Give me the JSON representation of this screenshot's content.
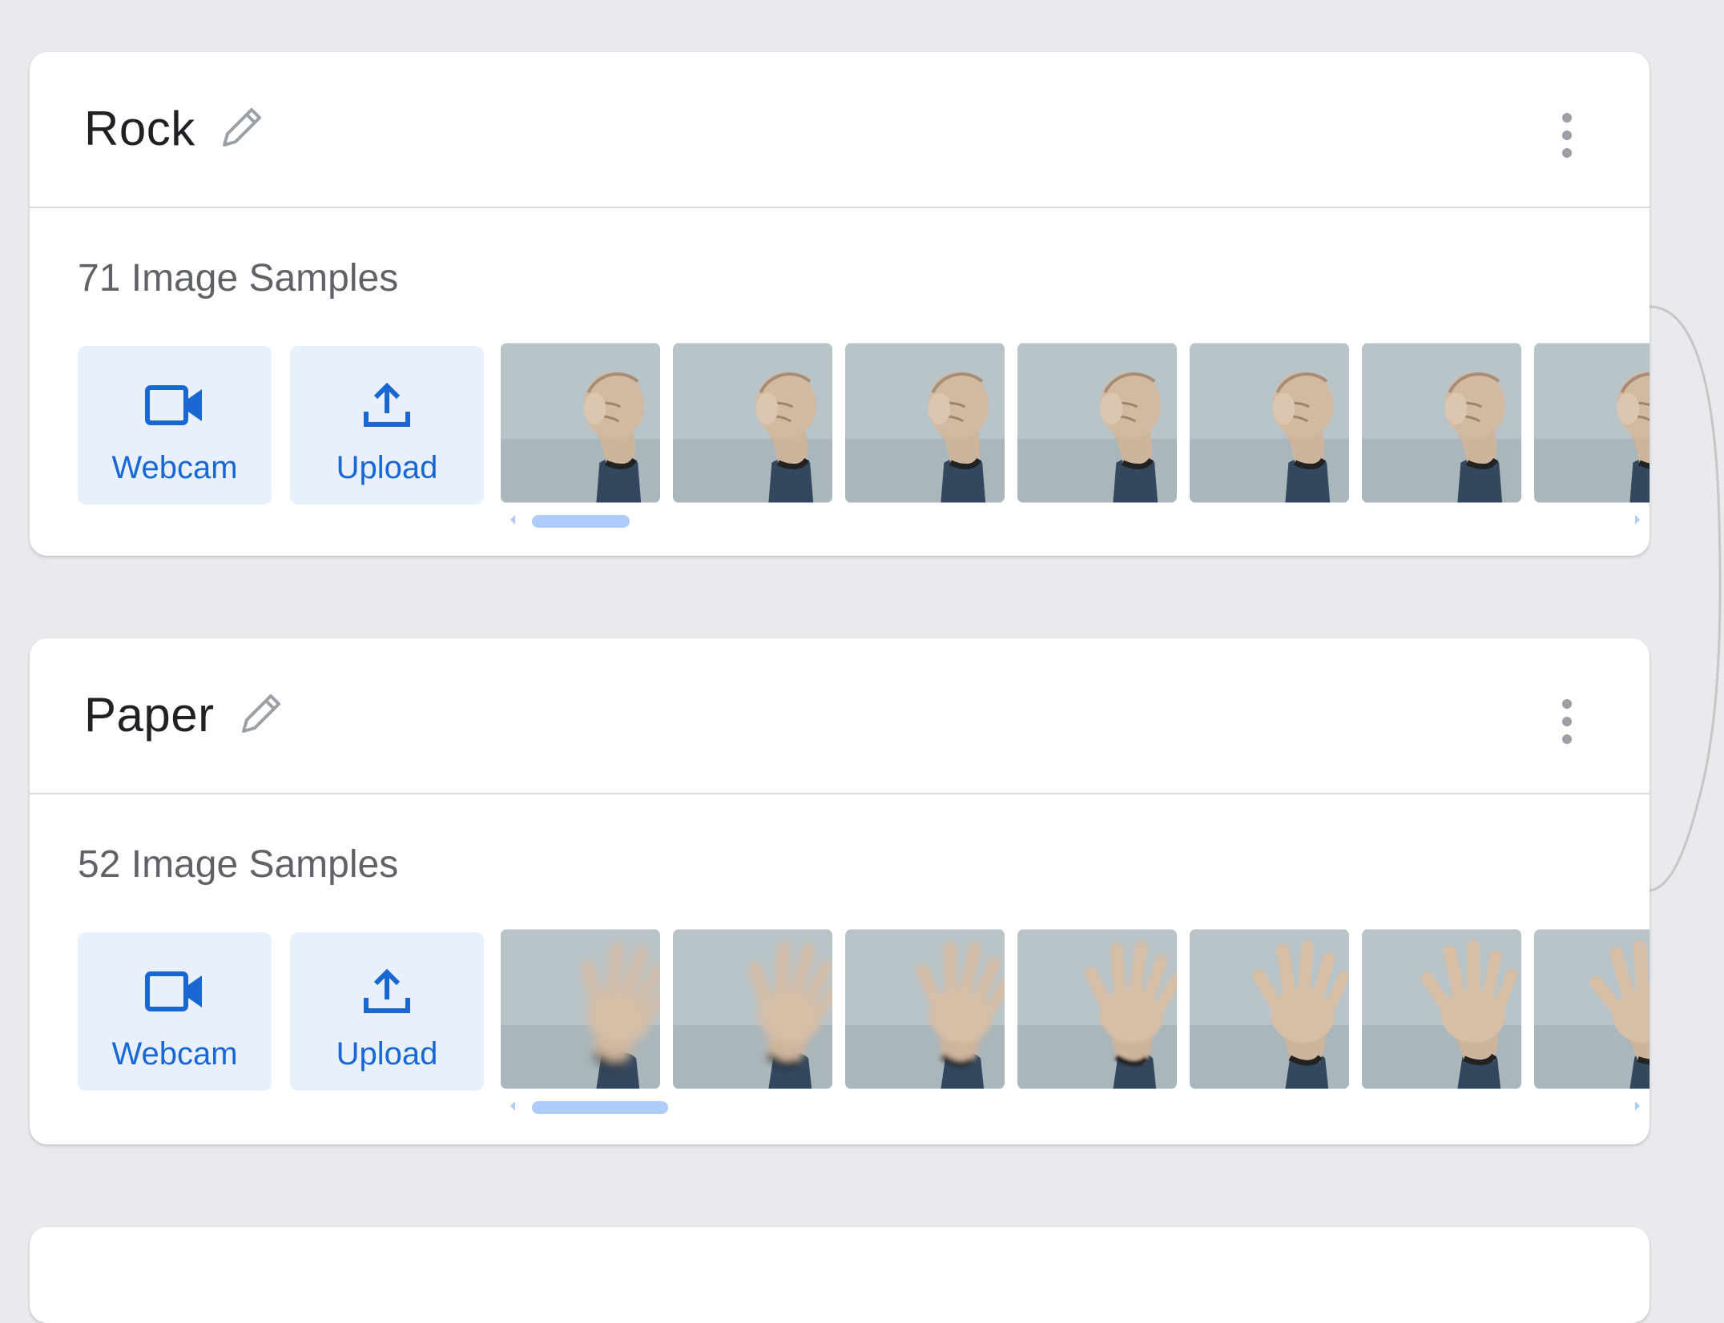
{
  "classes": [
    {
      "name": "Rock",
      "samples_label": "71 Image Samples",
      "webcam_label": "Webcam",
      "upload_label": "Upload",
      "gesture": "fist",
      "thumbnail_count": 7,
      "scroll_fraction": 0.09
    },
    {
      "name": "Paper",
      "samples_label": "52 Image Samples",
      "webcam_label": "Webcam",
      "upload_label": "Upload",
      "gesture": "open-palm",
      "thumbnail_count": 7,
      "scroll_fraction": 0.125
    }
  ],
  "icons": {
    "edit": "pencil-icon",
    "more": "more-vert-icon",
    "webcam": "videocam-icon",
    "upload": "upload-icon"
  },
  "colors": {
    "accent": "#1967d2",
    "button_bg": "#e8f0fe",
    "scroll_thumb": "#aecbfa",
    "page_bg": "#e8eaed"
  }
}
